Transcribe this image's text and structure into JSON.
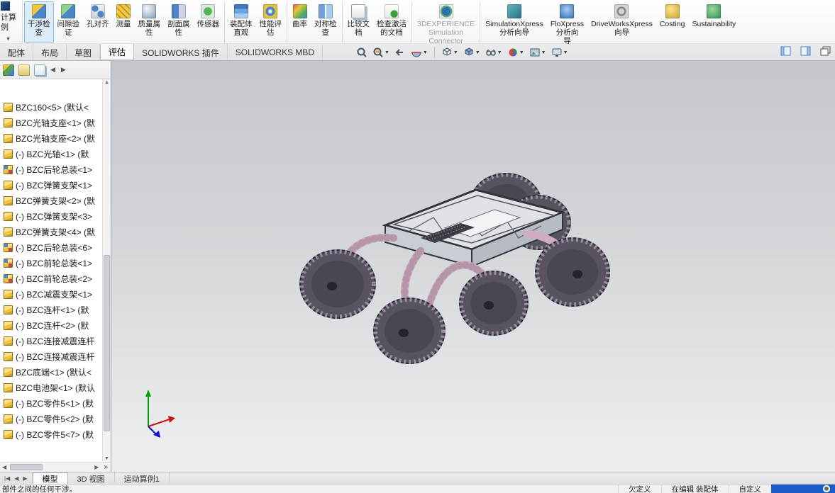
{
  "glyphs": {
    "caret": "▼",
    "up": "▲",
    "down": "▼",
    "left": "◀",
    "right": "▶",
    "expand": "»"
  },
  "left_strip": {
    "line1": "计算",
    "line2": "例",
    "caret": "▼"
  },
  "command_manager": {
    "buttons": [
      {
        "label": "干涉检\n查",
        "icon": "interference-check-icon",
        "active": true
      },
      {
        "label": "间隙验\n证",
        "icon": "clearance-verify-icon"
      },
      {
        "label": "孔对齐",
        "icon": "hole-alignment-icon"
      },
      {
        "label": "测量",
        "icon": "measure-icon"
      },
      {
        "label": "质量属\n性",
        "icon": "mass-properties-icon"
      },
      {
        "label": "剖面属\n性",
        "icon": "section-properties-icon"
      },
      {
        "label": "传感器",
        "icon": "sensor-icon"
      },
      {
        "label": "装配体\n直观",
        "icon": "assembly-visualization-icon",
        "sep": true
      },
      {
        "label": "性能评\n估",
        "icon": "performance-evaluation-icon"
      },
      {
        "label": "曲率",
        "icon": "curvature-icon",
        "sep": true
      },
      {
        "label": "对称检\n查",
        "icon": "symmetry-check-icon"
      },
      {
        "label": "比较文\n档",
        "icon": "compare-documents-icon",
        "sep": true
      },
      {
        "label": "检查激活\n的文档",
        "icon": "check-active-document-icon"
      },
      {
        "label": "3DEXPERIENCE\nSimulation\nConnector",
        "icon": "3dexperience-icon",
        "disabled": true,
        "sep": true
      },
      {
        "label": "SimulationXpress\n分析向导",
        "icon": "simulationxpress-icon",
        "sep": true
      },
      {
        "label": "FloXpress\n分析向\n导",
        "icon": "floxpress-icon"
      },
      {
        "label": "DriveWorksXpress\n向导",
        "icon": "driveworksxpress-icon"
      },
      {
        "label": "Costing",
        "icon": "costing-icon"
      },
      {
        "label": "Sustainability",
        "icon": "sustainability-icon"
      }
    ]
  },
  "ribbon_tabs": {
    "items": [
      {
        "label": "配体"
      },
      {
        "label": "布局"
      },
      {
        "label": "草图"
      },
      {
        "label": "评估",
        "active": true
      },
      {
        "label": "SOLIDWORKS 插件"
      },
      {
        "label": "SOLIDWORKS MBD"
      }
    ]
  },
  "headsup": {
    "icons": [
      "zoom-fit-icon",
      "zoom-area-icon",
      "previous-view-icon",
      "section-view-icon",
      "view-orientation-icon",
      "display-style-icon",
      "hide-show-items-icon",
      "edit-appearance-icon",
      "apply-scene-icon",
      "view-settings-icon"
    ]
  },
  "tabrow_right_icons": [
    "task-pane-left-icon",
    "task-pane-right-icon",
    "restore-window-icon"
  ],
  "feature_panel": {
    "header_icons": [
      "featuremanager-tree-icon",
      "propertymanager-icon",
      "configurationmanager-icon"
    ],
    "nav_left": "◀",
    "nav_right": "▶"
  },
  "feature_tree": {
    "items": [
      {
        "icon": "part-icon",
        "label": "BZC160<5> (默认<"
      },
      {
        "icon": "part-icon",
        "label": "BZC光轴支座<1> (默"
      },
      {
        "icon": "part-icon",
        "label": "BZC光轴支座<2> (默"
      },
      {
        "icon": "part-icon",
        "label": "(-) BZC光轴<1> (默"
      },
      {
        "icon": "assembly-icon",
        "label": "(-) BZC后轮总装<1>"
      },
      {
        "icon": "part-icon",
        "label": "(-) BZC弹簧支架<1>"
      },
      {
        "icon": "part-icon",
        "label": "BZC弹簧支架<2> (默"
      },
      {
        "icon": "part-icon",
        "label": "(-) BZC弹簧支架<3>"
      },
      {
        "icon": "part-icon",
        "label": "BZC弹簧支架<4> (默"
      },
      {
        "icon": "assembly-icon",
        "label": "(-) BZC后轮总装<6>"
      },
      {
        "icon": "assembly-icon",
        "label": "(-) BZC前轮总装<1>"
      },
      {
        "icon": "assembly-icon",
        "label": "(-) BZC前轮总装<2>"
      },
      {
        "icon": "part-icon",
        "label": "(-) BZC减震支架<1>"
      },
      {
        "icon": "part-icon",
        "label": "(-) BZC连杆<1> (默"
      },
      {
        "icon": "part-icon",
        "label": "(-) BZC连杆<2> (默"
      },
      {
        "icon": "part-icon",
        "label": "(-) BZC连接减震连杆"
      },
      {
        "icon": "part-icon",
        "label": "(-) BZC连接减震连杆"
      },
      {
        "icon": "part-icon",
        "label": "BZC底端<1> (默认<"
      },
      {
        "icon": "part-icon",
        "label": "BZC电池架<1> (默认"
      },
      {
        "icon": "part-icon",
        "label": "(-) BZC零件5<1> (默"
      },
      {
        "icon": "part-icon",
        "label": "(-) BZC零件5<2> (默"
      },
      {
        "icon": "part-icon",
        "label": "(-) BZC零件5<7> (默"
      }
    ]
  },
  "viewport": {
    "triad": {
      "x_color": "#cc1111",
      "y_color": "#00a000",
      "z_color": "#1111cc"
    }
  },
  "bottom_tabs": {
    "nav": [
      "|◀",
      "◀",
      "▶"
    ],
    "items": [
      {
        "label": "模型",
        "active": true
      },
      {
        "label": "3D 视图"
      },
      {
        "label": "运动算例1"
      }
    ]
  },
  "status_bar": {
    "message": "部件之间的任何干涉。",
    "fields": [
      "欠定义",
      "在编辑 装配体",
      "自定义"
    ],
    "brand_color": "#1b5cc8"
  }
}
